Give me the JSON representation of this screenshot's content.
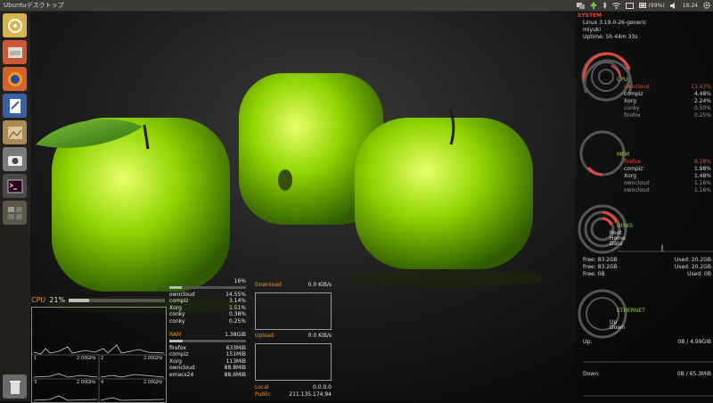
{
  "top_panel": {
    "title": "Ubuntuデスクトップ",
    "battery": "(99%)",
    "clock": "18:24"
  },
  "launcher": {
    "items": [
      {
        "name": "dash-home-icon"
      },
      {
        "name": "files-icon"
      },
      {
        "name": "firefox-icon"
      },
      {
        "name": "libreoffice-writer-icon"
      },
      {
        "name": "image-viewer-icon"
      },
      {
        "name": "camera-icon"
      },
      {
        "name": "terminal-icon"
      },
      {
        "name": "workspace-switcher-icon"
      },
      {
        "name": "trash-icon"
      }
    ]
  },
  "cpu_panel": {
    "label": "CPU",
    "percent": "21%",
    "percent_value": 21,
    "cores": [
      {
        "num": "1",
        "freq": "2.00GHz"
      },
      {
        "num": "2",
        "freq": "2.00GHz"
      },
      {
        "num": "3",
        "freq": "2.00GHz"
      },
      {
        "num": "4",
        "freq": "2.00GHz"
      }
    ]
  },
  "process_panel": {
    "cpu_total": "16%",
    "cpu_procs": [
      {
        "name": "owncloud",
        "value": "14.55%"
      },
      {
        "name": "compiz",
        "value": "3.14%"
      },
      {
        "name": "Xorg",
        "value": "1.51%"
      },
      {
        "name": "conky",
        "value": "0.38%"
      },
      {
        "name": "conky",
        "value": "0.25%"
      }
    ],
    "ram_label": "RAM",
    "ram_total": "1.38GiB",
    "mem_procs": [
      {
        "name": "firefox",
        "value": "633MiB"
      },
      {
        "name": "compiz",
        "value": "151MiB"
      },
      {
        "name": "Xorg",
        "value": "113MiB"
      },
      {
        "name": "owncloud",
        "value": "88.8MiB"
      },
      {
        "name": "emacs24",
        "value": "88.6MiB"
      }
    ]
  },
  "net_panel": {
    "download_label": "Download",
    "download_value": "0.0 KiB/s",
    "upload_label": "Upload",
    "upload_value": "0.0 KiB/s",
    "local_label": "Local",
    "local_value": "0.0.0.0",
    "public_label": "Public",
    "public_value": "211.135.174.94"
  },
  "system_panel": {
    "header": "SYSTEM",
    "kernel": "Linux 3.19.0-26-generic",
    "host": "miyuki",
    "uptime": "Uptime: 5h 44m 33s",
    "cpu_label": "CPU",
    "cpu_procs": [
      {
        "name": "owncloud",
        "value": "13.43%"
      },
      {
        "name": "compiz",
        "value": "4.48%"
      },
      {
        "name": "Xorg",
        "value": "2.24%"
      },
      {
        "name": "conky",
        "value": "0.50%"
      },
      {
        "name": "firefox",
        "value": "0.25%"
      }
    ],
    "mem_label": "MEM",
    "mem_procs": [
      {
        "name": "firefox",
        "value": "8.28%"
      },
      {
        "name": "compiz",
        "value": "1.98%"
      },
      {
        "name": "Xorg",
        "value": "1.48%"
      },
      {
        "name": "owncloud",
        "value": "1.16%"
      },
      {
        "name": "owncloud",
        "value": "1.16%"
      }
    ],
    "disks_label": "DISKS",
    "disk_names": [
      "Root",
      "Home",
      "Data"
    ],
    "disk_rows": [
      {
        "free": "Free: 83.2GB",
        "used": "Used: 20.2GB"
      },
      {
        "free": "Free: 83.2GB",
        "used": "Used: 20.2GB"
      },
      {
        "free": "Free: 0B",
        "used": "Used: 0B"
      }
    ],
    "ethernet_label": "ETHERNET",
    "eth_up": "Up",
    "eth_down": "Down",
    "up_label": "Up:",
    "up_value": "0B",
    "up_total": "/ 4.99GiB",
    "down_label": "Down:",
    "down_value": "0B",
    "down_total": "/ 65.3MiB"
  },
  "colors": {
    "accent_red": "#e24a3c",
    "accent_orange": "#e8962e",
    "accent_green": "#8fd14a",
    "panel": "#3c3b37"
  }
}
